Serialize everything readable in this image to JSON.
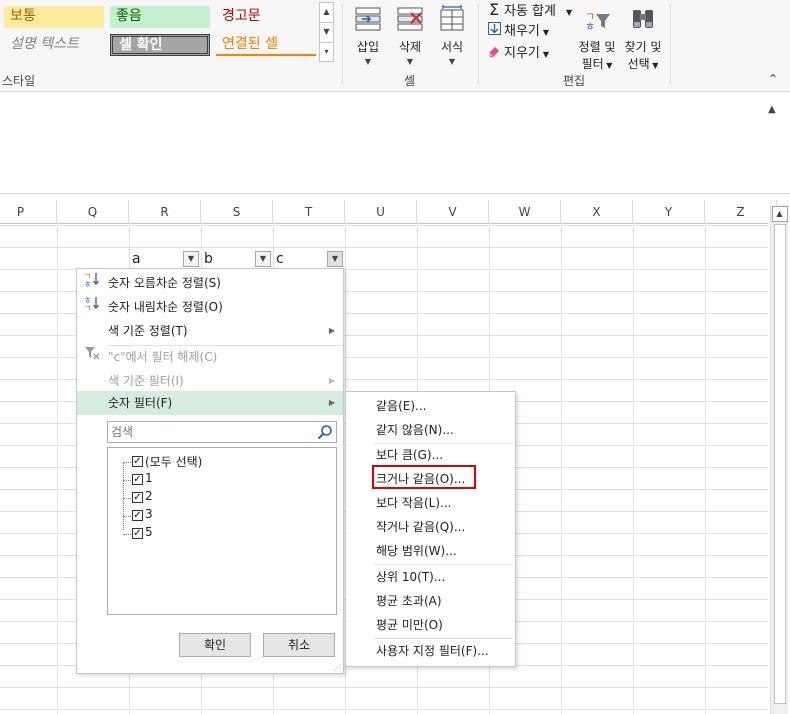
{
  "ribbon": {
    "styles": {
      "normal": "보통",
      "good": "좋음",
      "warning": "경고문",
      "explanatory": "설명 텍스트",
      "check_cell": "셀 확인",
      "linked_cell": "연결된 셀",
      "group_label": "스타일"
    },
    "cells_group": {
      "insert": "삽입",
      "delete": "삭제",
      "format": "서식",
      "group_label": "셀"
    },
    "editing_group": {
      "autosum": "자동 합계",
      "fill": "채우기",
      "clear": "지우기",
      "sort_filter_line1": "정렬 및",
      "sort_filter_line2": "필터",
      "find_select_line1": "찾기 및",
      "find_select_line2": "선택",
      "group_label": "편집"
    }
  },
  "columns": [
    "P",
    "Q",
    "R",
    "S",
    "T",
    "U",
    "V",
    "W",
    "X",
    "Y",
    "Z"
  ],
  "header_cells": {
    "a": "a",
    "b": "b",
    "c": "c"
  },
  "filter_menu": {
    "sort_asc": "숫자 오름차순 정렬(S)",
    "sort_desc": "숫자 내림차순 정렬(O)",
    "sort_by_color": "색 기준 정렬(T)",
    "clear_filter": "\"c\"에서 필터 해제(C)",
    "filter_by_color": "색 기준 필터(I)",
    "number_filters": "숫자 필터(F)",
    "search_placeholder": "검색",
    "checklist": [
      "(모두 선택)",
      "1",
      "2",
      "3",
      "5"
    ],
    "ok": "확인",
    "cancel": "취소"
  },
  "number_filter_submenu": {
    "equals": "같음(E)...",
    "not_equals": "같지 않음(N)...",
    "greater_than": "보다 큼(G)...",
    "greater_or_equal": "크거나 같음(O)...",
    "less_than": "보다 작음(L)...",
    "less_or_equal": "작거나 같음(Q)...",
    "between": "해당 범위(W)...",
    "top10": "상위 10(T)...",
    "above_average": "평균 초과(A)",
    "below_average": "평균 미만(O)",
    "custom": "사용자 지정 필터(F)..."
  },
  "colors": {
    "menu_hover": "#d5ecdf",
    "highlight_box": "#e00000",
    "sort_icon_orange": "#e07000",
    "sort_icon_blue": "#2b5fb3"
  },
  "icons": {
    "sort_asc": "sort-ascending-icon",
    "sort_desc": "sort-descending-icon",
    "clear_filter": "clear-filter-icon",
    "search": "search-icon",
    "submenu": "chevron-right-icon",
    "dropdown": "chevron-down-icon"
  }
}
